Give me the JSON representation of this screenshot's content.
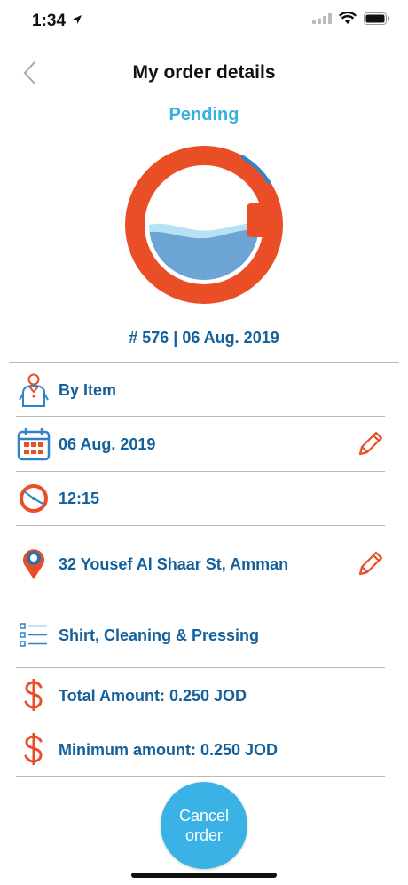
{
  "status_bar": {
    "time": "1:34"
  },
  "nav": {
    "title": "My order details"
  },
  "order": {
    "status": "Pending",
    "reference": "# 576 | 06 Aug. 2019"
  },
  "details": {
    "service_type": "By Item",
    "date": "06 Aug. 2019",
    "time": "12:15",
    "address": "32 Yousef Al Shaar St, Amman",
    "items": "Shirt, Cleaning & Pressing",
    "total_amount": "Total Amount: 0.250 JOD",
    "minimum_amount": "Minimum amount: 0.250 JOD"
  },
  "actions": {
    "cancel_label": "Cancel order"
  },
  "colors": {
    "accent_blue": "#14609a",
    "light_blue": "#36b0e0",
    "orange": "#e94e26"
  }
}
